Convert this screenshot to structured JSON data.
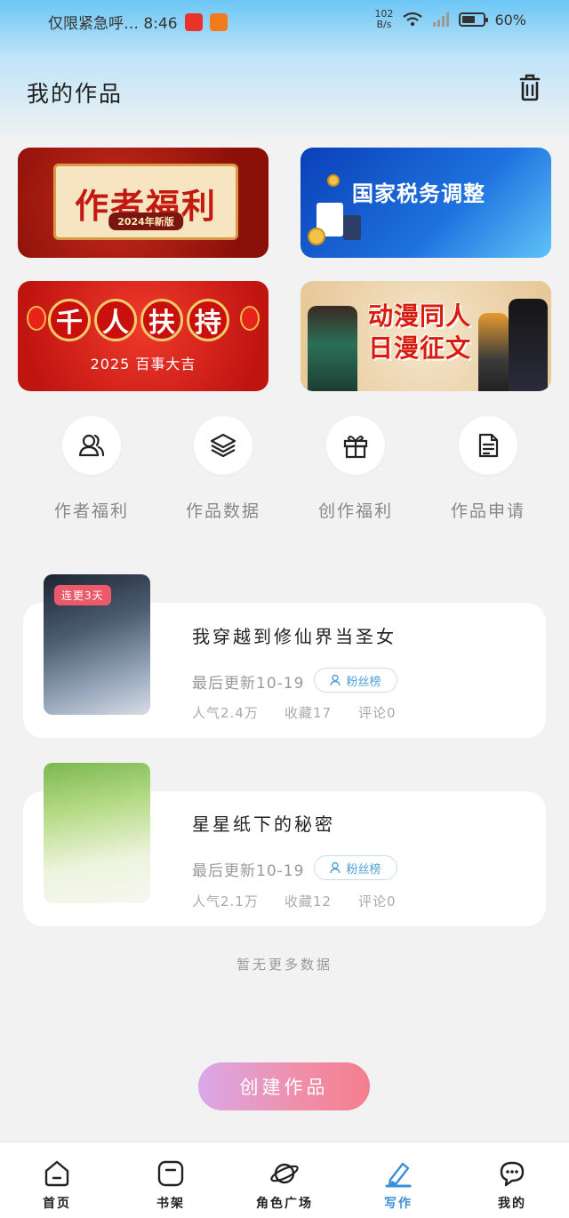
{
  "status_bar": {
    "left_text": "仅限紧急呼… 8:46",
    "speed_value": "102",
    "speed_unit": "B/s",
    "battery": "60%",
    "battery_level": 0.6
  },
  "header": {
    "title": "我的作品"
  },
  "banners": [
    {
      "title": "作者福利",
      "subtitle": "2024年新版"
    },
    {
      "title": "国家税务调整"
    },
    {
      "title_chars": [
        "千",
        "人",
        "扶",
        "持"
      ],
      "subtitle": "2025 百事大吉"
    },
    {
      "title_line1": "动漫同人",
      "title_line2": "日漫征文"
    }
  ],
  "quick_actions": [
    {
      "label": "作者福利",
      "icon": "users-icon"
    },
    {
      "label": "作品数据",
      "icon": "layers-icon"
    },
    {
      "label": "创作福利",
      "icon": "gift-icon"
    },
    {
      "label": "作品申请",
      "icon": "document-icon"
    }
  ],
  "works": [
    {
      "title": "我穿越到修仙界当圣女",
      "badge": "连更3天",
      "last_update": "最后更新10-19",
      "fans_label": "粉丝榜",
      "popularity": "人气2.4万",
      "favorites": "收藏17",
      "comments": "评论0"
    },
    {
      "title": "星星纸下的秘密",
      "last_update": "最后更新10-19",
      "fans_label": "粉丝榜",
      "popularity": "人气2.1万",
      "favorites": "收藏12",
      "comments": "评论0"
    }
  ],
  "no_more_text": "暂无更多数据",
  "create_button": "创建作品",
  "bottom_nav": [
    {
      "label": "首页",
      "icon": "home-icon"
    },
    {
      "label": "书架",
      "icon": "bookshelf-icon"
    },
    {
      "label": "角色广场",
      "icon": "planet-icon"
    },
    {
      "label": "写作",
      "icon": "pen-icon",
      "active": true
    },
    {
      "label": "我的",
      "icon": "chat-icon"
    }
  ],
  "colors": {
    "accent": "#3b8fd9",
    "create_gradient_start": "#d9a8e8",
    "create_gradient_end": "#f47e8e",
    "badge": "#ea5a6a"
  }
}
